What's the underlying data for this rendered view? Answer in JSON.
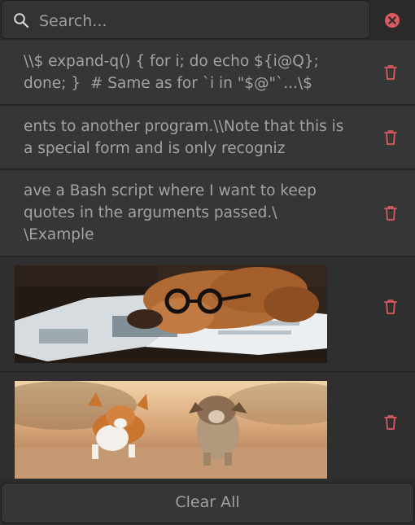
{
  "search": {
    "placeholder": "Search...",
    "value": ""
  },
  "items": [
    {
      "type": "text",
      "text": "\\\\$ expand-q() { for i; do echo ${i@Q}; done; }  # Same as for `i in \"$@\"`...\\$"
    },
    {
      "type": "text",
      "text": "ents to another program.\\\\Note that this is a special form and is only recogniz"
    },
    {
      "type": "text",
      "text": "ave a Bash script where I want to keep quotes in the arguments passed.\\\n\\Example"
    },
    {
      "type": "image",
      "subject": "dog-wearing-glasses-reading-magazine"
    },
    {
      "type": "image",
      "subject": "corgi-and-yorkshire-terrier-running"
    }
  ],
  "footer": {
    "clear_all_label": "Clear All"
  },
  "colors": {
    "background": "#2b2b2b",
    "row_text": "#363636",
    "row_image": "#2f2f2f",
    "accent_delete": "#d95b61"
  }
}
